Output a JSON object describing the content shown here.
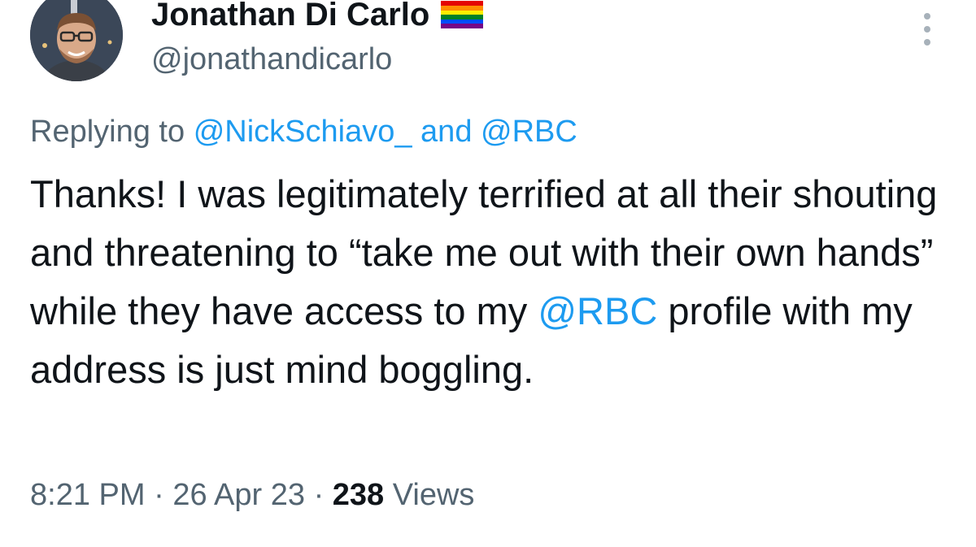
{
  "author": {
    "display_name": "Jonathan Di Carlo",
    "handle": "@jonathandicarlo",
    "badge": "rainbow-flag-icon",
    "avatar": "profile-photo"
  },
  "more_menu": {
    "icon": "more-vertical-icon"
  },
  "reply": {
    "prefix": "Replying to",
    "mention_1": "@NickSchiavo_",
    "joiner": "and",
    "mention_2": "@RBC"
  },
  "tweet": {
    "text_before": "Thanks! I was legitimately terrified at all their shouting and threatening to “take me out with their own hands” while they have access to my ",
    "mention": "@RBC",
    "text_after": " profile with my address is just mind boggling."
  },
  "meta": {
    "time": "8:21 PM",
    "separator_1": "·",
    "date": "26 Apr 23",
    "separator_2": "·",
    "views_count": "238",
    "views_label": "Views"
  },
  "colors": {
    "link": "#1d9bf0",
    "secondary_text": "#536471",
    "primary_text": "#0f1419",
    "background": "#ffffff"
  }
}
